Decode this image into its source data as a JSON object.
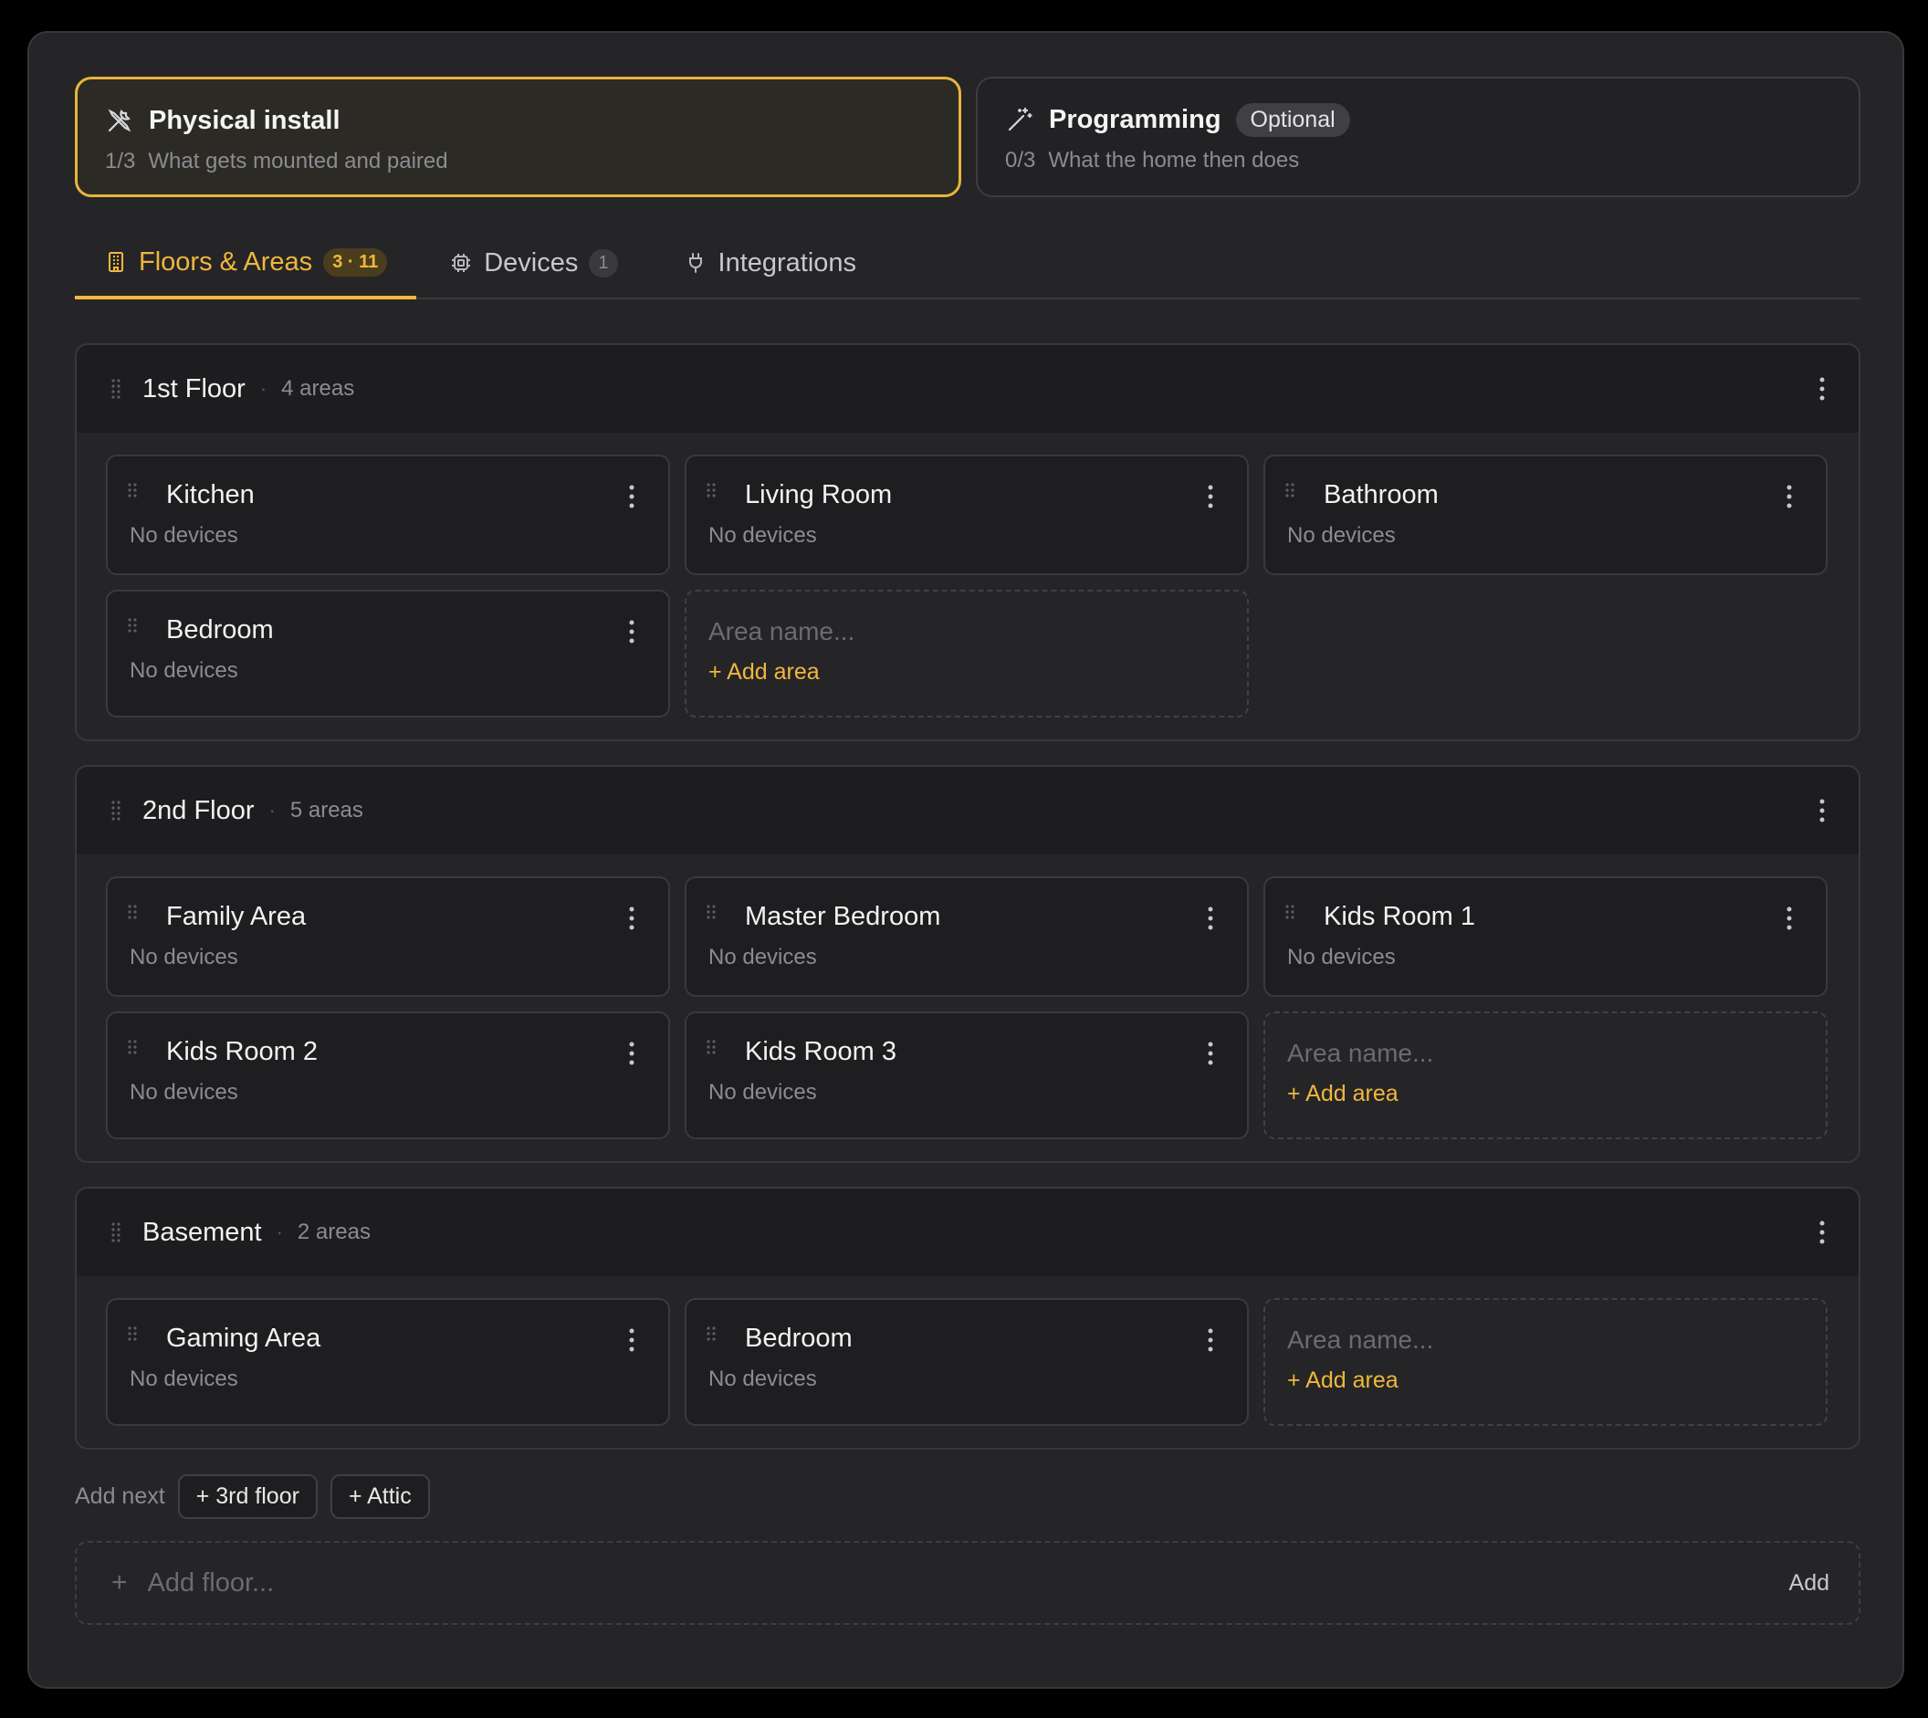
{
  "steps": [
    {
      "title": "Physical install",
      "progress": "1/3",
      "subtitle": "What gets mounted and paired",
      "icon": "tools-icon",
      "active": true
    },
    {
      "title": "Programming",
      "badge": "Optional",
      "progress": "0/3",
      "subtitle": "What the home then does",
      "icon": "magic-wand-icon",
      "active": false
    }
  ],
  "tabs": [
    {
      "label": "Floors & Areas",
      "count": "3 · 11",
      "icon": "building-icon",
      "active": true
    },
    {
      "label": "Devices",
      "count": "1",
      "icon": "chip-icon",
      "active": false
    },
    {
      "label": "Integrations",
      "icon": "plug-icon",
      "active": false
    }
  ],
  "floors": [
    {
      "name": "1st Floor",
      "count": "4 areas",
      "areas": [
        {
          "name": "Kitchen",
          "status": "No devices"
        },
        {
          "name": "Living Room",
          "status": "No devices"
        },
        {
          "name": "Bathroom",
          "status": "No devices"
        },
        {
          "name": "Bedroom",
          "status": "No devices"
        }
      ]
    },
    {
      "name": "2nd Floor",
      "count": "5 areas",
      "areas": [
        {
          "name": "Family Area",
          "status": "No devices"
        },
        {
          "name": "Master Bedroom",
          "status": "No devices"
        },
        {
          "name": "Kids Room 1",
          "status": "No devices"
        },
        {
          "name": "Kids Room 2",
          "status": "No devices"
        },
        {
          "name": "Kids Room 3",
          "status": "No devices"
        }
      ]
    },
    {
      "name": "Basement",
      "count": "2 areas",
      "areas": [
        {
          "name": "Gaming Area",
          "status": "No devices"
        },
        {
          "name": "Bedroom",
          "status": "No devices"
        }
      ]
    }
  ],
  "add_area": {
    "placeholder": "Area name...",
    "button": "+ Add area"
  },
  "add_next": {
    "label": "Add next",
    "chips": [
      "+ 3rd floor",
      "+ Attic"
    ]
  },
  "add_floor": {
    "placeholder": "Add floor...",
    "plus": "+",
    "button": "Add"
  },
  "colors": {
    "accent": "#f0b73c",
    "background": "#252527",
    "card": "#1e1e20"
  }
}
